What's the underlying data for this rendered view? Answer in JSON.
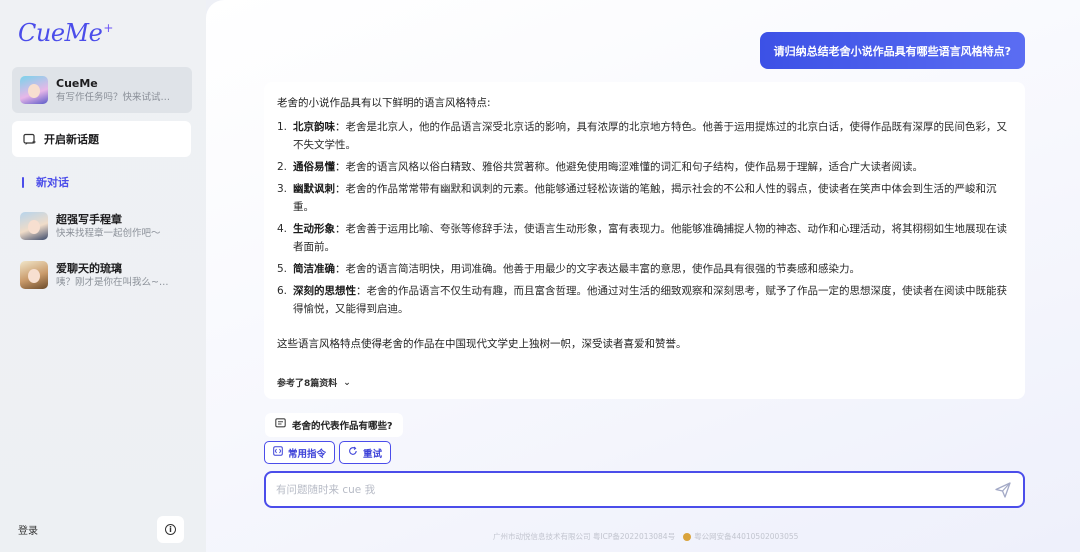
{
  "sidebar": {
    "logo": "CueMe",
    "logo_spark": "+",
    "conversations": [
      {
        "title": "CueMe",
        "subtitle": "有写作任务吗？快来试试我..."
      },
      {
        "title": "超强写手程章",
        "subtitle": "快来找程章一起创作吧～"
      },
      {
        "title": "爱聊天的琉璃",
        "subtitle": "咦？刚才是你在叫我么~（..."
      }
    ],
    "new_topic": "开启新话题",
    "new_conversation": "新对话",
    "login": "登录",
    "info_glyph": "i"
  },
  "chat": {
    "user_message": "请归纳总结老舍小说作品具有哪些语言风格特点?",
    "answer": {
      "intro": "老舍的小说作品具有以下鲜明的语言风格特点:",
      "items": [
        {
          "num": "1.",
          "term": "北京韵味",
          "text": "：老舍是北京人，他的作品语言深受北京话的影响，具有浓厚的北京地方特色。他善于运用提炼过的北京白话，使得作品既有深厚的民间色彩，又不失文学性。"
        },
        {
          "num": "2.",
          "term": "通俗易懂",
          "text": "：老舍的语言风格以俗白精致、雅俗共赏著称。他避免使用晦涩难懂的词汇和句子结构，使作品易于理解，适合广大读者阅读。"
        },
        {
          "num": "3.",
          "term": "幽默讽刺",
          "text": "：老舍的作品常常带有幽默和讽刺的元素。他能够通过轻松诙谐的笔触，揭示社会的不公和人性的弱点，使读者在笑声中体会到生活的严峻和沉重。"
        },
        {
          "num": "4.",
          "term": "生动形象",
          "text": "：老舍善于运用比喻、夸张等修辞手法，使语言生动形象，富有表现力。他能够准确捕捉人物的神态、动作和心理活动，将其栩栩如生地展现在读者面前。"
        },
        {
          "num": "5.",
          "term": "简洁准确",
          "text": "：老舍的语言简洁明快，用词准确。他善于用最少的文字表达最丰富的意思，使作品具有很强的节奏感和感染力。"
        },
        {
          "num": "6.",
          "term": "深刻的思想性",
          "text": "：老舍的作品语言不仅生动有趣，而且富含哲理。他通过对生活的细致观察和深刻思考，赋予了作品一定的思想深度，使读者在阅读中既能获得愉悦，又能得到启迪。"
        }
      ],
      "outro": "这些语言风格特点使得老舍的作品在中国现代文学史上独树一帜，深受读者喜爱和赞誉。",
      "refs": "参考了8篇资料",
      "refs_chevron": "⌄"
    },
    "suggestion": "老舍的代表作品有哪些?",
    "chips": {
      "commands": "常用指令",
      "retry": "重试"
    },
    "input": {
      "placeholder": "有问题随时来 cue 我",
      "value": ""
    },
    "footer": {
      "company": "广州市动悦信息技术有限公司 粤ICP备2022013084号",
      "police": "粤公网安备44010502003055"
    }
  },
  "colors": {
    "accent": "#4b4dea",
    "user_bubble": "#4356e8",
    "sidebar_bg": "#eff1f4"
  }
}
